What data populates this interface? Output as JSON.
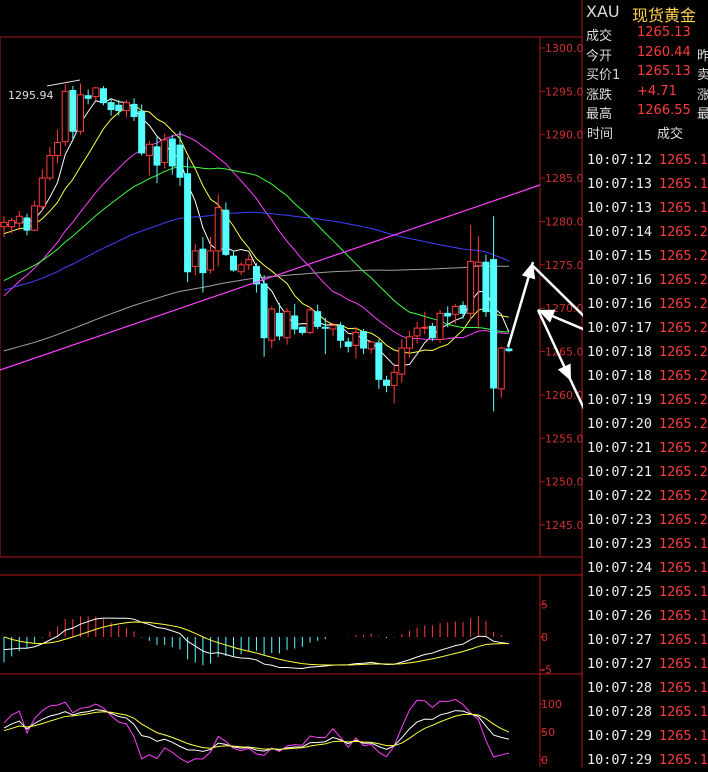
{
  "header": {
    "symbol": "XAU",
    "name": "现货黄金"
  },
  "quote": [
    {
      "label": "成交",
      "value": "1265.13",
      "label2": ""
    },
    {
      "label": "今开",
      "value": "1260.44",
      "label2": "昨"
    },
    {
      "label": "买价1",
      "value": "1265.13",
      "label2": "卖"
    },
    {
      "label": "涨跌",
      "value": "+4.71",
      "label2": "涨"
    },
    {
      "label": "最高",
      "value": "1266.55",
      "label2": "最"
    }
  ],
  "ticks_header": {
    "time": "时间",
    "trade": "成交"
  },
  "ticks": [
    {
      "time": "10:07:12",
      "price": "1265.1"
    },
    {
      "time": "10:07:13",
      "price": "1265.1"
    },
    {
      "time": "10:07:13",
      "price": "1265.1"
    },
    {
      "time": "10:07:14",
      "price": "1265.2"
    },
    {
      "time": "10:07:15",
      "price": "1265.2"
    },
    {
      "time": "10:07:16",
      "price": "1265.2"
    },
    {
      "time": "10:07:16",
      "price": "1265.2"
    },
    {
      "time": "10:07:17",
      "price": "1265.2"
    },
    {
      "time": "10:07:18",
      "price": "1265.2"
    },
    {
      "time": "10:07:18",
      "price": "1265.2"
    },
    {
      "time": "10:07:19",
      "price": "1265.2"
    },
    {
      "time": "10:07:20",
      "price": "1265.2"
    },
    {
      "time": "10:07:21",
      "price": "1265.2"
    },
    {
      "time": "10:07:21",
      "price": "1265.2"
    },
    {
      "time": "10:07:22",
      "price": "1265.2"
    },
    {
      "time": "10:07:23",
      "price": "1265.2"
    },
    {
      "time": "10:07:23",
      "price": "1265.1"
    },
    {
      "time": "10:07:24",
      "price": "1265.1"
    },
    {
      "time": "10:07:25",
      "price": "1265.1"
    },
    {
      "time": "10:07:26",
      "price": "1265.1"
    },
    {
      "time": "10:07:27",
      "price": "1265.1"
    },
    {
      "time": "10:07:27",
      "price": "1265.1"
    },
    {
      "time": "10:07:28",
      "price": "1265.1"
    },
    {
      "time": "10:07:28",
      "price": "1265.1"
    },
    {
      "time": "10:07:29",
      "price": "1265.1"
    },
    {
      "time": "10:07:29",
      "price": "1265.1"
    }
  ],
  "colors": {
    "up": "#ff3c3c",
    "down": "#54ffff",
    "axis": "#b01818",
    "ma5": "#ffffff",
    "ma10": "#ffff40",
    "ma20": "#ff40ff",
    "ma30": "#40ff40",
    "ma60": "#4040ff",
    "ma120": "#a0a0a0",
    "trend": "#ff40ff",
    "arrow": "#ffffff"
  },
  "chart_data": {
    "type": "candlestick",
    "ylim": [
      1240,
      1302
    ],
    "yticks": [
      "1300.0",
      "1295.0",
      "1290.0",
      "1285.0",
      "1280.0",
      "1275.0",
      "1270.0",
      "1265.0",
      "1260.0",
      "1255.0",
      "1250.0",
      "1245.0"
    ],
    "high_label": "1295.94",
    "candles": [
      [
        1279.4,
        1280.6,
        1278.2,
        1279.9
      ],
      [
        1279.4,
        1280.4,
        1278.6,
        1280.1
      ],
      [
        1279.8,
        1281.2,
        1279.0,
        1280.6
      ],
      [
        1280.4,
        1280.9,
        1278.4,
        1279.0
      ],
      [
        1279.0,
        1282.4,
        1278.9,
        1281.8
      ],
      [
        1281.7,
        1286.0,
        1281.2,
        1285.0
      ],
      [
        1285.0,
        1288.6,
        1284.7,
        1287.6
      ],
      [
        1287.6,
        1290.6,
        1286.7,
        1289.1
      ],
      [
        1289.2,
        1295.8,
        1288.7,
        1295.0
      ],
      [
        1295.1,
        1295.6,
        1289.5,
        1290.4
      ],
      [
        1290.4,
        1295.9,
        1290.0,
        1294.6
      ],
      [
        1294.5,
        1295.2,
        1293.5,
        1294.2
      ],
      [
        1294.4,
        1295.5,
        1294.0,
        1295.4
      ],
      [
        1295.3,
        1295.6,
        1293.4,
        1293.7
      ],
      [
        1293.7,
        1294.2,
        1292.2,
        1292.9
      ],
      [
        1293.4,
        1294.0,
        1292.2,
        1292.8
      ],
      [
        1292.8,
        1294.0,
        1292.0,
        1293.7
      ],
      [
        1293.5,
        1294.2,
        1291.6,
        1292.1
      ],
      [
        1292.7,
        1293.5,
        1287.6,
        1287.9
      ],
      [
        1287.6,
        1289.3,
        1285.3,
        1288.9
      ],
      [
        1288.6,
        1289.7,
        1284.4,
        1286.5
      ],
      [
        1286.8,
        1290.1,
        1286.1,
        1289.4
      ],
      [
        1289.5,
        1290.0,
        1285.4,
        1286.4
      ],
      [
        1288.8,
        1290.4,
        1284.1,
        1285.1
      ],
      [
        1285.5,
        1287.4,
        1273.0,
        1274.2
      ],
      [
        1274.8,
        1277.4,
        1273.8,
        1276.6
      ],
      [
        1276.8,
        1278.2,
        1271.8,
        1274.1
      ],
      [
        1274.4,
        1278.2,
        1274.0,
        1276.6
      ],
      [
        1276.6,
        1283.1,
        1274.8,
        1281.6
      ],
      [
        1281.3,
        1282.2,
        1276.0,
        1276.2
      ],
      [
        1276.0,
        1276.6,
        1274.2,
        1274.4
      ],
      [
        1274.2,
        1275.3,
        1273.8,
        1275.0
      ],
      [
        1275.0,
        1276.2,
        1274.4,
        1275.6
      ],
      [
        1274.8,
        1275.2,
        1271.8,
        1272.8
      ],
      [
        1272.8,
        1273.8,
        1264.4,
        1266.6
      ],
      [
        1266.3,
        1270.2,
        1265.4,
        1269.9
      ],
      [
        1269.4,
        1270.6,
        1266.3,
        1266.8
      ],
      [
        1266.6,
        1270.0,
        1265.8,
        1269.6
      ],
      [
        1269.1,
        1270.5,
        1267.0,
        1267.6
      ],
      [
        1267.8,
        1267.9,
        1266.9,
        1267.2
      ],
      [
        1267.2,
        1270.1,
        1267.0,
        1269.8
      ],
      [
        1269.6,
        1270.4,
        1267.6,
        1267.9
      ],
      [
        1267.8,
        1268.9,
        1264.7,
        1267.7
      ],
      [
        1267.6,
        1268.3,
        1266.8,
        1268.0
      ],
      [
        1268.0,
        1268.4,
        1265.4,
        1266.3
      ],
      [
        1266.1,
        1266.6,
        1264.9,
        1265.6
      ],
      [
        1265.7,
        1267.8,
        1264.2,
        1267.2
      ],
      [
        1267.3,
        1267.6,
        1264.7,
        1265.4
      ],
      [
        1265.3,
        1266.2,
        1264.8,
        1266.1
      ],
      [
        1266.0,
        1266.4,
        1260.7,
        1261.8
      ],
      [
        1261.7,
        1262.2,
        1260.3,
        1261.1
      ],
      [
        1261.1,
        1263.6,
        1259.0,
        1262.6
      ],
      [
        1262.4,
        1266.4,
        1261.4,
        1265.4
      ],
      [
        1265.4,
        1267.4,
        1264.3,
        1266.7
      ],
      [
        1266.8,
        1268.4,
        1265.9,
        1267.7
      ],
      [
        1267.7,
        1269.6,
        1267.0,
        1267.8
      ],
      [
        1267.9,
        1268.3,
        1266.2,
        1266.6
      ],
      [
        1266.4,
        1269.8,
        1266.0,
        1269.4
      ],
      [
        1269.4,
        1270.2,
        1267.8,
        1269.1
      ],
      [
        1269.3,
        1270.5,
        1268.2,
        1270.2
      ],
      [
        1270.3,
        1270.8,
        1268.8,
        1269.4
      ],
      [
        1269.4,
        1279.6,
        1268.6,
        1275.4
      ],
      [
        1274.9,
        1278.3,
        1267.6,
        1275.3
      ],
      [
        1275.3,
        1276.2,
        1269.0,
        1269.6
      ],
      [
        1275.6,
        1280.6,
        1258.1,
        1260.8
      ],
      [
        1260.7,
        1265.6,
        1259.7,
        1265.4
      ],
      [
        1265.3,
        1265.6,
        1264.9,
        1265.1
      ]
    ],
    "macd": {
      "yticks": [
        "5",
        "0",
        "-5"
      ],
      "ylim": [
        -6,
        8
      ]
    },
    "kdj": {
      "yticks": [
        "100",
        "50",
        "0"
      ],
      "ylim": [
        -8,
        118
      ]
    }
  }
}
